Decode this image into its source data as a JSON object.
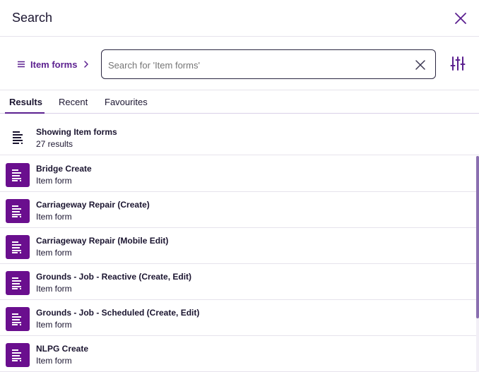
{
  "header": {
    "title": "Search"
  },
  "search": {
    "breadcrumb_label": "Item forms",
    "placeholder": "Search for 'Item forms'"
  },
  "tabs": [
    {
      "label": "Results",
      "active": true
    },
    {
      "label": "Recent",
      "active": false
    },
    {
      "label": "Favourites",
      "active": false
    }
  ],
  "summary": {
    "title": "Showing Item forms",
    "subtitle": "27 results"
  },
  "results": [
    {
      "title": "Bridge Create",
      "subtitle": "Item form"
    },
    {
      "title": "Carriageway Repair (Create)",
      "subtitle": "Item form"
    },
    {
      "title": "Carriageway Repair (Mobile Edit)",
      "subtitle": "Item form"
    },
    {
      "title": "Grounds - Job - Reactive (Create, Edit)",
      "subtitle": "Item form"
    },
    {
      "title": "Grounds - Job - Scheduled (Create, Edit)",
      "subtitle": "Item form"
    },
    {
      "title": "NLPG Create",
      "subtitle": "Item form"
    }
  ],
  "icons": {
    "close": "close-icon",
    "menu": "menu-icon",
    "chevron": "chevron-right-icon",
    "clear": "clear-icon",
    "filter": "filter-sliders-icon",
    "form": "form-icon"
  },
  "colors": {
    "accent": "#5b1f8f",
    "icon_tile": "#6a0f8e",
    "text": "#1b1530"
  }
}
